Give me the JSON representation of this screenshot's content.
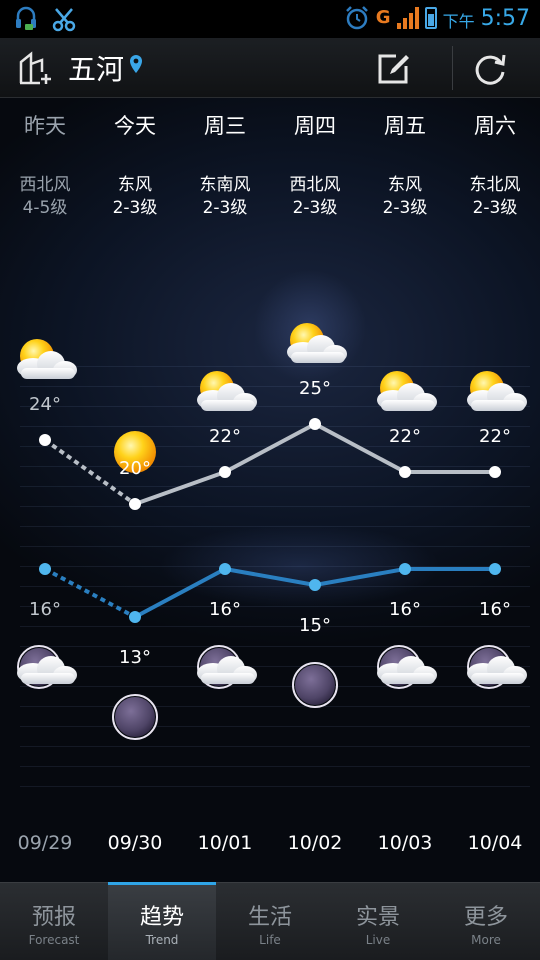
{
  "status_bar": {
    "ampm": "下午",
    "time": "5:57",
    "network_label": "G",
    "icons": [
      "headset-icon",
      "scissors-icon",
      "alarm-icon",
      "signal-icon",
      "battery-icon"
    ]
  },
  "header": {
    "city": "五河",
    "icons": [
      "add-city-icon",
      "location-pin-icon",
      "edit-icon",
      "refresh-icon"
    ]
  },
  "days": [
    {
      "day": "昨天",
      "wind_dir": "西北风",
      "wind_level": "4-5级",
      "date": "09/29",
      "high": "24°",
      "low": "16°",
      "day_icon": "partly-cloudy-icon",
      "night_icon": "night-cloudy-icon",
      "dim": true
    },
    {
      "day": "今天",
      "wind_dir": "东风",
      "wind_level": "2-3级",
      "date": "09/30",
      "high": "20°",
      "low": "13°",
      "day_icon": "sunny-icon",
      "night_icon": "night-clear-icon",
      "dim": false
    },
    {
      "day": "周三",
      "wind_dir": "东南风",
      "wind_level": "2-3级",
      "date": "10/01",
      "high": "22°",
      "low": "16°",
      "day_icon": "partly-cloudy-icon",
      "night_icon": "night-cloudy-icon",
      "dim": false
    },
    {
      "day": "周四",
      "wind_dir": "西北风",
      "wind_level": "2-3级",
      "date": "10/02",
      "high": "25°",
      "low": "15°",
      "day_icon": "partly-cloudy-icon",
      "night_icon": "night-clear-icon",
      "dim": false
    },
    {
      "day": "周五",
      "wind_dir": "东风",
      "wind_level": "2-3级",
      "date": "10/03",
      "high": "22°",
      "low": "16°",
      "day_icon": "partly-cloudy-icon",
      "night_icon": "night-cloudy-icon",
      "dim": false
    },
    {
      "day": "周六",
      "wind_dir": "东北风",
      "wind_level": "2-3级",
      "date": "10/04",
      "high": "22°",
      "low": "16°",
      "day_icon": "partly-cloudy-icon",
      "night_icon": "night-cloudy-icon",
      "dim": false
    }
  ],
  "chart_data": {
    "type": "line",
    "categories": [
      "09/29",
      "09/30",
      "10/01",
      "10/02",
      "10/03",
      "10/04"
    ],
    "series": [
      {
        "values": [
          24,
          20,
          22,
          25,
          22,
          22
        ],
        "color": "#b8bec6"
      },
      {
        "values": [
          16,
          13,
          16,
          15,
          16,
          16
        ],
        "color": "#2a7fc0"
      }
    ],
    "first_segment_dotted": true
  },
  "tabs": [
    {
      "zh": "预报",
      "en": "Forecast",
      "active": false
    },
    {
      "zh": "趋势",
      "en": "Trend",
      "active": true
    },
    {
      "zh": "生活",
      "en": "Life",
      "active": false
    },
    {
      "zh": "实景",
      "en": "Live",
      "active": false
    },
    {
      "zh": "更多",
      "en": "More",
      "active": false
    }
  ],
  "colors": {
    "accent": "#2fa4e7",
    "high_line": "#b8bec6",
    "low_line": "#2a7fc0",
    "low_dot": "#4fb6ee"
  }
}
